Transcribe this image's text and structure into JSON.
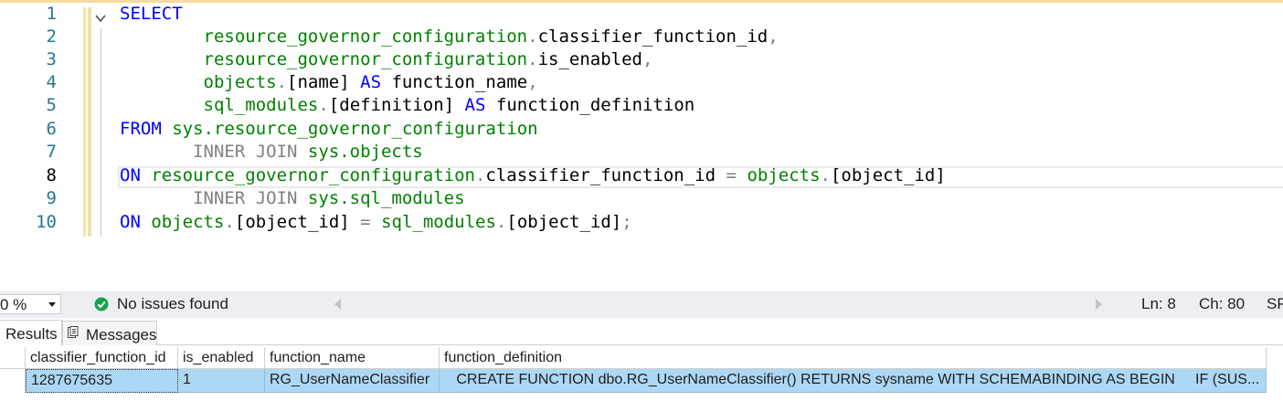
{
  "editor": {
    "line_numbers": [
      "1",
      "2",
      "3",
      "4",
      "5",
      "6",
      "7",
      "8",
      "9",
      "10"
    ],
    "current_line": "8",
    "lines": {
      "l1": {
        "kw": "SELECT"
      },
      "l2": {
        "obj": "resource_governor_configuration",
        "dot": ".",
        "col": "classifier_function_id",
        "punct": ","
      },
      "l3": {
        "obj": "resource_governor_configuration",
        "dot": ".",
        "col": "is_enabled",
        "punct": ","
      },
      "l4": {
        "obj": "objects",
        "dot": ".",
        "col": "[name]",
        "kw": "AS",
        "alias": "function_name",
        "punct": ","
      },
      "l5": {
        "obj": "sql_modules",
        "dot": ".",
        "col": "[definition]",
        "kw": "AS",
        "alias": "function_definition"
      },
      "l6": {
        "kw": "FROM",
        "obj": "sys.resource_governor_configuration"
      },
      "l7": {
        "join": "INNER JOIN",
        "obj": "sys.objects"
      },
      "l8": {
        "kw": "ON",
        "obj": "resource_governor_configuration",
        "dot": ".",
        "col": "classifier_function_id",
        "op": "=",
        "obj2": "objects",
        "dot2": ".",
        "col2": "[object_id]"
      },
      "l9": {
        "join": "INNER JOIN",
        "obj": "sys.sql_modules"
      },
      "l10": {
        "kw": "ON",
        "obj": "objects",
        "dot": ".",
        "col": "[object_id]",
        "op": "=",
        "obj2": "sql_modules",
        "dot2": ".",
        "col2": "[object_id]",
        "punct": ";"
      }
    }
  },
  "status": {
    "zoom": "0 %",
    "issues": "No issues found",
    "line": "Ln: 8",
    "col": "Ch: 80",
    "spc": "SP"
  },
  "tabs": {
    "results": "Results",
    "messages": "Messages"
  },
  "grid": {
    "columns": [
      "classifier_function_id",
      "is_enabled",
      "function_name",
      "function_definition"
    ],
    "rows": [
      [
        "1287675635",
        "1",
        "RG_UserNameClassifier",
        "   CREATE FUNCTION dbo.RG_UserNameClassifier() RETURNS sysname WITH SCHEMABINDING AS BEGIN     IF (SUS..."
      ]
    ]
  },
  "colors": {
    "keyword": "#0000ff",
    "object": "#008000",
    "operator": "#808080",
    "selection": "#add8f5",
    "ok_icon": "#16a34a"
  },
  "icons": {
    "fold": "chevron-down-icon",
    "status": "check-circle-icon",
    "messages": "document-icon"
  }
}
